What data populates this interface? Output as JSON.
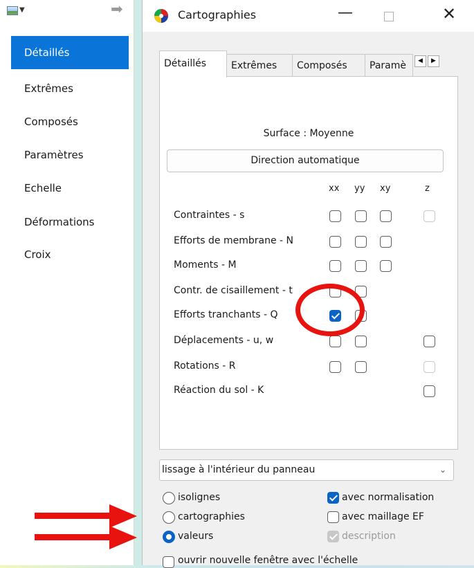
{
  "nav": {
    "items": [
      {
        "label": "Détaillés",
        "active": true
      },
      {
        "label": "Extrêmes"
      },
      {
        "label": "Composés"
      },
      {
        "label": "Paramètres"
      },
      {
        "label": "Echelle"
      },
      {
        "label": "Déformations"
      },
      {
        "label": "Croix"
      }
    ]
  },
  "dialog": {
    "title": "Cartographies",
    "tabs": [
      {
        "label": "Détaillés",
        "active": true
      },
      {
        "label": "Extrêmes"
      },
      {
        "label": "Composés"
      },
      {
        "label": "Paramè"
      }
    ],
    "surface_label": "Surface : Moyenne",
    "direction_button": "Direction automatique",
    "columns": [
      "xx",
      "yy",
      "xy",
      "z"
    ],
    "rows": [
      {
        "label": "Contraintes - s",
        "xx": false,
        "yy": false,
        "xy": false,
        "z": "disabled"
      },
      {
        "label": "Efforts de membrane - N",
        "xx": false,
        "yy": false,
        "xy": false
      },
      {
        "label": "Moments - M",
        "xx": false,
        "yy": false,
        "xy": false
      },
      {
        "label": "Contr. de cisaillement - t",
        "xx": false,
        "yy": false
      },
      {
        "label": "Efforts tranchants - Q",
        "xx": true,
        "yy": false
      },
      {
        "label": "Déplacements - u, w",
        "xx": false,
        "yy": false,
        "z": false
      },
      {
        "label": "Rotations - R",
        "xx": false,
        "yy": false,
        "z": "disabled"
      },
      {
        "label": "Réaction du sol - K",
        "z": false
      }
    ],
    "smoothing": {
      "value": "lissage à l'intérieur du panneau"
    },
    "display_options": {
      "isolignes": {
        "label": "isolignes",
        "checked": false
      },
      "cartographies": {
        "label": "cartographies",
        "checked": false
      },
      "valeurs": {
        "label": "valeurs",
        "checked": true
      }
    },
    "checks": {
      "normalisation": {
        "label": "avec normalisation",
        "checked": true
      },
      "maillage": {
        "label": "avec maillage EF",
        "checked": false
      },
      "description": {
        "label": "description",
        "checked": true,
        "disabled": true
      }
    },
    "new_window": {
      "label": "ouvrir nouvelle fenêtre avec l'échelle"
    }
  },
  "colors": {
    "accent": "#0a74d9",
    "annotation": "#e8130f"
  }
}
